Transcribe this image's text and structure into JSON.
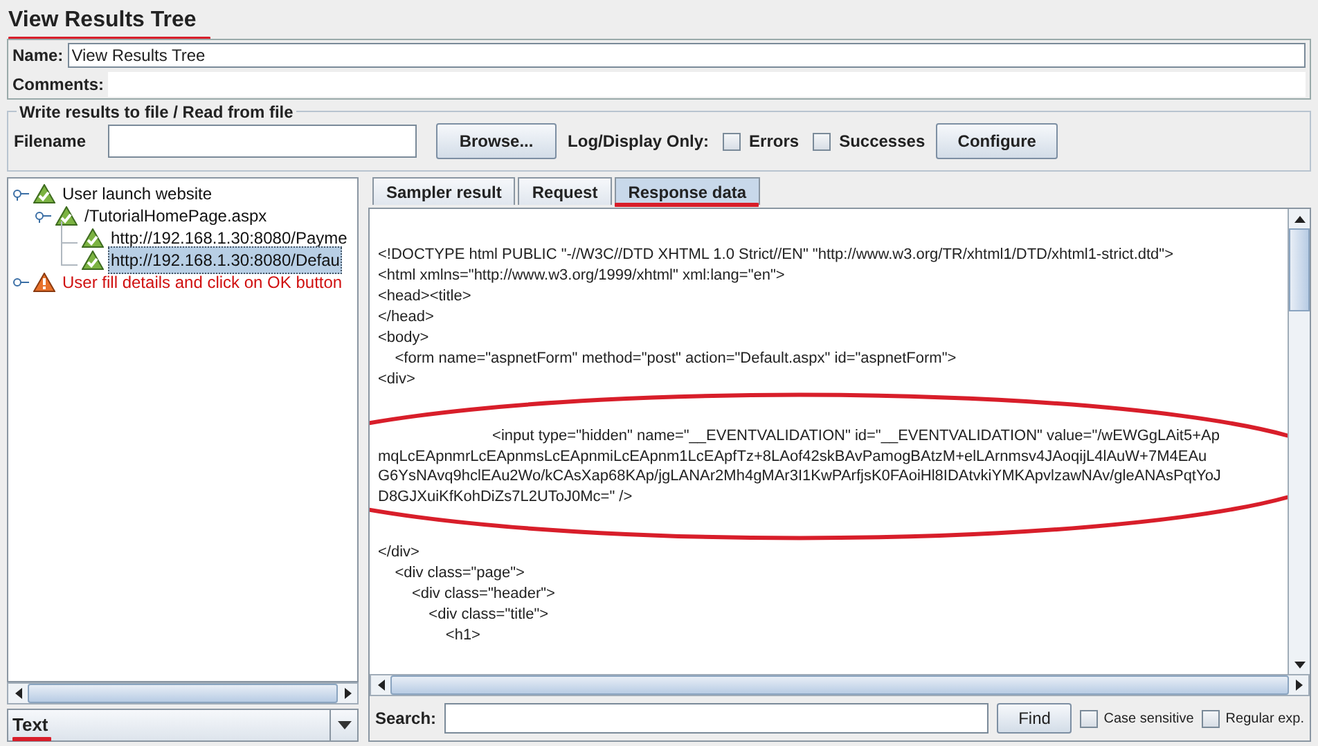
{
  "title": "View Results Tree",
  "name_field": {
    "label": "Name:",
    "value": "View Results Tree"
  },
  "comments_field": {
    "label": "Comments:"
  },
  "file_group": {
    "legend": "Write results to file / Read from file",
    "filename_label": "Filename",
    "browse": "Browse...",
    "log_label": "Log/Display Only:",
    "checkboxes": [
      {
        "label": "Errors",
        "checked": false
      },
      {
        "label": "Successes",
        "checked": false
      }
    ],
    "configure": "Configure"
  },
  "tree": [
    {
      "label": "User launch website",
      "kind": "success",
      "selected": false,
      "expanded": true,
      "children": [
        {
          "label": "/TutorialHomePage.aspx",
          "kind": "success",
          "selected": false,
          "expanded": true,
          "children": [
            {
              "label": "http://192.168.1.30:8080/Payme",
              "kind": "success",
              "selected": false
            },
            {
              "label": "http://192.168.1.30:8080/Defau",
              "kind": "success",
              "selected": true
            }
          ]
        }
      ]
    },
    {
      "label": "User fill details and click on OK button",
      "kind": "warning",
      "selected": false,
      "expanded": false
    }
  ],
  "renderer": "Text",
  "tabs": [
    {
      "label": "Sampler result",
      "selected": false
    },
    {
      "label": "Request",
      "selected": false
    },
    {
      "label": "Response data",
      "selected": true
    }
  ],
  "response_lines": [
    {
      "text": "<!DOCTYPE html PUBLIC \"-//W3C//DTD XHTML 1.0 Strict//EN\" \"http://www.w3.org/TR/xhtml1/DTD/xhtml1-strict.dtd\">",
      "circled": false
    },
    {
      "text": "<html xmlns=\"http://www.w3.org/1999/xhtml\" xml:lang=\"en\">",
      "circled": false
    },
    {
      "text": "<head><title>",
      "circled": false
    },
    {
      "text": "</head>",
      "circled": false
    },
    {
      "text": "<body>",
      "circled": false
    },
    {
      "text": "    <form name=\"aspnetForm\" method=\"post\" action=\"Default.aspx\" id=\"aspnetForm\">",
      "circled": false
    },
    {
      "text": "<div>",
      "circled": false
    },
    {
      "text": "                           <input type=\"hidden\" name=\"__EVENTVALIDATION\" id=\"__EVENTVALIDATION\" value=\"/wEWGgLAit5+Ap",
      "circled": true
    },
    {
      "text": "mqLcEApnmrLcEApnmsLcEApnmiLcEApnm1LcEApfTz+8LAof42skBAvPamogBAtzM+elLArnmsv4JAoqijL4lAuW+7M4EAu",
      "circled": true
    },
    {
      "text": "G6YsNAvq9hclEAu2Wo/kCAsXap68KAp/jgLANAr2Mh4gMAr3I1KwPArfjsK0FAoiHl8IDAtvkiYMKApvlzawNAv/gleANAsPqtYoJ",
      "circled": true
    },
    {
      "text": "D8GJXuiKfKohDiZs7L2UToJ0Mc=\" />",
      "circled": true
    },
    {
      "text": "</div>",
      "circled": false
    },
    {
      "text": "    <div class=\"page\">",
      "circled": false
    },
    {
      "text": "        <div class=\"header\">",
      "circled": false
    },
    {
      "text": "            <div class=\"title\">",
      "circled": false
    },
    {
      "text": "                <h1>",
      "circled": false
    }
  ],
  "search": {
    "label": "Search:",
    "find": "Find",
    "options": [
      {
        "label": "Case sensitive",
        "checked": false
      },
      {
        "label": "Regular exp.",
        "checked": false
      }
    ]
  }
}
